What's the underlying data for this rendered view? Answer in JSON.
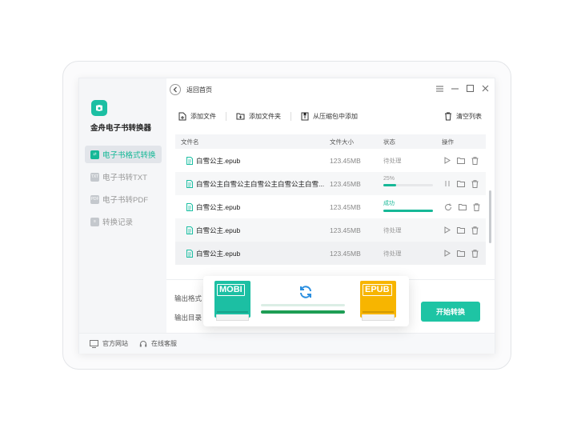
{
  "app": {
    "name": "金舟电子书转换器"
  },
  "sidebar": {
    "items": [
      {
        "label": "电子书格式转换",
        "active": true,
        "icon": "convert-icon"
      },
      {
        "label": "电子书转TXT",
        "active": false,
        "icon": "txt-icon"
      },
      {
        "label": "电子书转PDF",
        "active": false,
        "icon": "pdf-icon"
      },
      {
        "label": "转换记录",
        "active": false,
        "icon": "history-icon"
      }
    ]
  },
  "titlebar": {
    "back_label": "返回首页"
  },
  "toolbar": {
    "add_file": "添加文件",
    "add_folder": "添加文件夹",
    "add_from_archive": "从压缩包中添加",
    "clear_list": "清空列表"
  },
  "table": {
    "headers": {
      "name": "文件名",
      "size": "文件大小",
      "status": "状态",
      "ops": "操作"
    },
    "rows": [
      {
        "name": "白雪公主.epub",
        "size": "123.45MB",
        "status": "待处理"
      },
      {
        "name": "白雪公主白雪公主白雪公主白雪公主白雪...",
        "size": "123.45MB",
        "status": "25%",
        "progress": 0.25
      },
      {
        "name": "白雪公主.epub",
        "size": "123.45MB",
        "status": "成功",
        "progress": 1.0
      },
      {
        "name": "白雪公主.epub",
        "size": "123.45MB",
        "status": "待处理"
      },
      {
        "name": "白雪公主.epub",
        "size": "123.45MB",
        "status": "待处理"
      }
    ]
  },
  "settings": {
    "output_format_label": "输出格式",
    "output_dir_label": "输出目录",
    "start_button": "开始转换"
  },
  "popup": {
    "from_format": "MOBI",
    "to_format": "EPUB"
  },
  "footer": {
    "website": "官方网站",
    "support": "在线客服"
  },
  "colors": {
    "accent": "#1ec4a4",
    "mobi": "#1cbfa3",
    "epub": "#f7b500",
    "progress_dark": "#1e9e55"
  }
}
